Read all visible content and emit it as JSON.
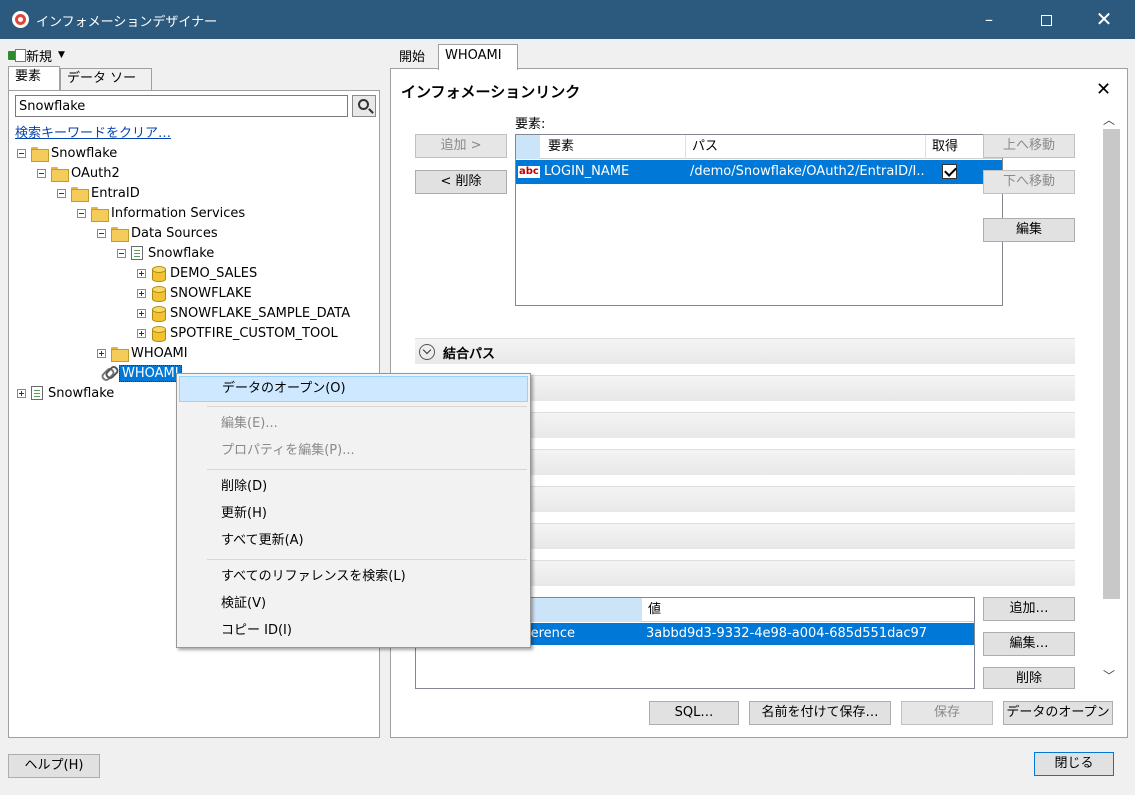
{
  "window": {
    "title": "インフォメーションデザイナー",
    "minimize": "–",
    "close": "✕"
  },
  "left": {
    "new_label": "新規",
    "tabs": [
      "要素",
      "データ ソース"
    ],
    "search": {
      "value": "Snowflake"
    },
    "clear_link": "検索キーワードをクリア…",
    "tree": {
      "root_snowflake": "Snowflake",
      "oauth2": "OAuth2",
      "entraid": "EntraID",
      "information_services": "Information Services",
      "data_sources": "Data Sources",
      "ds_snowflake": "Snowflake",
      "demo_sales": "DEMO_SALES",
      "snowflake_db": "SNOWFLAKE",
      "sample_data": "SNOWFLAKE_SAMPLE_DATA",
      "custom_tool": "SPOTFIRE_CUSTOM_TOOL",
      "whoami_folder": "WHOAMI",
      "whoami_link": "WHOAMI",
      "snowflake_bottom": "Snowflake"
    }
  },
  "right": {
    "tabs": [
      "開始",
      "WHOAMI"
    ],
    "panel_title": "インフォメーションリンク",
    "panel_close": "✕",
    "buttons": {
      "add": "追加 >",
      "remove": "< 削除",
      "move_up": "上へ移動",
      "move_down": "下へ移動",
      "edit": "編集",
      "prop_add": "追加…",
      "prop_edit": "編集…",
      "prop_delete": "削除",
      "sql": "SQL…",
      "save_as": "名前を付けて保存…",
      "save": "保存",
      "open_data": "データのオープン"
    },
    "elements_label": "要素:",
    "elements_grid": {
      "headers": [
        "要素",
        "パス",
        "取得"
      ],
      "rows": [
        {
          "element": "LOGIN_NAME",
          "path": "/demo/Snowflake/OAuth2/EntraID/I...",
          "retrieve": true
        }
      ]
    },
    "join_path_label": "結合パス",
    "properties_grid": {
      "value_header": "値",
      "rows": [
        {
          "name": "ference",
          "value": "3abbd9d3-9332-4e98-a004-685d551dac97"
        }
      ]
    }
  },
  "footer": {
    "help": "ヘルプ(H)",
    "close": "閉じる"
  },
  "context_menu": {
    "items": [
      {
        "label": "データのオープン(O)",
        "highlighted": true,
        "enabled": true
      },
      {
        "label": "編集(E)...",
        "enabled": false
      },
      {
        "label": "プロパティを編集(P)...",
        "enabled": false
      },
      {
        "label": "削除(D)",
        "enabled": true
      },
      {
        "label": "更新(H)",
        "enabled": true
      },
      {
        "label": "すべて更新(A)",
        "enabled": true
      },
      {
        "label": "すべてのリファレンスを検索(L)",
        "enabled": true
      },
      {
        "label": "検証(V)",
        "enabled": true
      },
      {
        "label": "コピー ID(I)",
        "enabled": true
      }
    ]
  }
}
